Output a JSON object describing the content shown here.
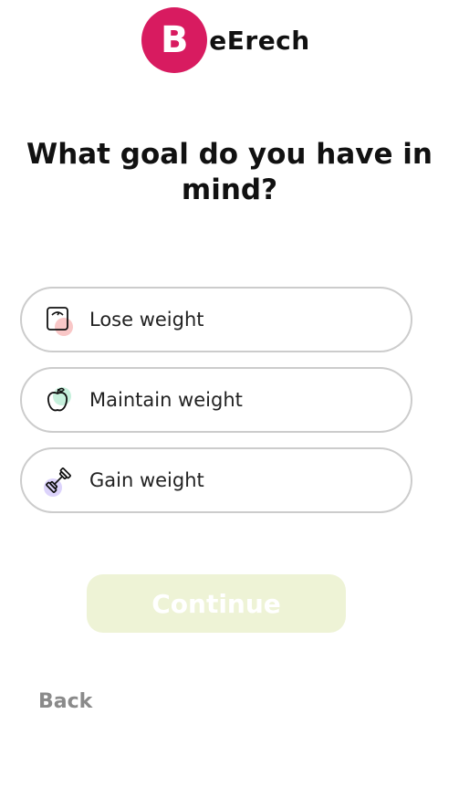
{
  "brand": {
    "logo_letter": "B",
    "name": "eErech",
    "color": "#d81b60"
  },
  "question": {
    "title": "What goal do you have in mind?"
  },
  "options": [
    {
      "label": "Lose weight",
      "icon": "scale-icon",
      "accent": "#f9c7c7"
    },
    {
      "label": "Maintain weight",
      "icon": "apple-icon",
      "accent": "#c6f0dc"
    },
    {
      "label": "Gain weight",
      "icon": "dumbbell-icon",
      "accent": "#dcd3fb"
    }
  ],
  "actions": {
    "continue_label": "Continue",
    "back_label": "Back",
    "continue_color": "#eef3d6"
  }
}
